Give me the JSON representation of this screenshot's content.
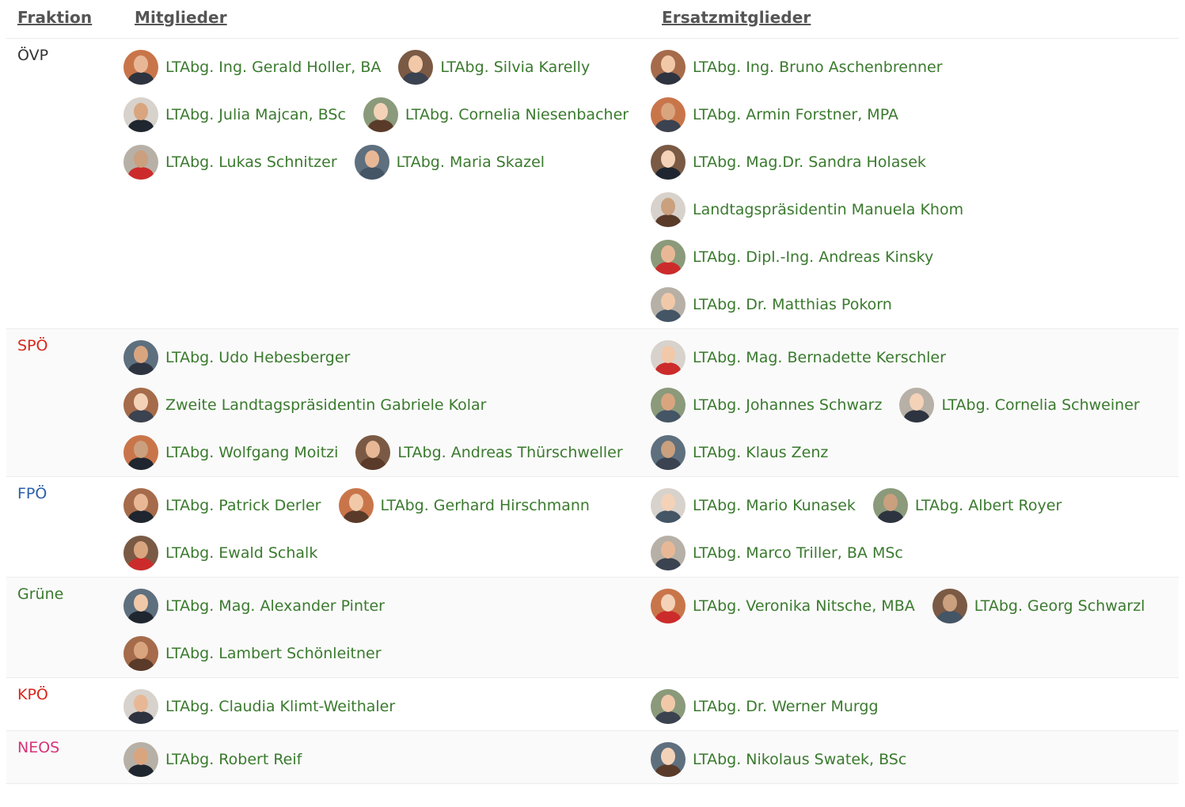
{
  "header": {
    "fraktion": "Fraktion",
    "mitglieder": "Mitglieder",
    "ersatzmitglieder": "Ersatzmitglieder"
  },
  "colors": {
    "link": "#3a7a2e",
    "ÖVP": "#333333",
    "SPÖ": "#d9261c",
    "FPÖ": "#2b5fab",
    "Grüne": "#3a7a2e",
    "KPÖ": "#d9261c",
    "NEOS": "#d6347a"
  },
  "rows": [
    {
      "party": "ÖVP",
      "members": [
        [
          "LTAbg. Ing. Gerald Holler, BA",
          "LTAbg. Silvia Karelly"
        ],
        [
          "LTAbg. Julia Majcan, BSc",
          "LTAbg. Cornelia Niesenbacher"
        ],
        [
          "LTAbg. Lukas Schnitzer",
          "LTAbg. Maria Skazel"
        ]
      ],
      "substitutes": [
        [
          "LTAbg. Ing. Bruno Aschenbrenner"
        ],
        [
          "LTAbg. Armin Forstner, MPA"
        ],
        [
          "LTAbg. Mag.Dr. Sandra Holasek"
        ],
        [
          "Landtagspräsidentin Manuela Khom"
        ],
        [
          "LTAbg. Dipl.-Ing. Andreas Kinsky"
        ],
        [
          "LTAbg. Dr. Matthias Pokorn"
        ]
      ]
    },
    {
      "party": "SPÖ",
      "members": [
        [
          "LTAbg. Udo Hebesberger"
        ],
        [
          "Zweite Landtagspräsidentin Gabriele Kolar"
        ],
        [
          "LTAbg. Wolfgang Moitzi",
          "LTAbg. Andreas Thürschweller"
        ]
      ],
      "substitutes": [
        [
          "LTAbg. Mag. Bernadette Kerschler"
        ],
        [
          "LTAbg. Johannes Schwarz",
          "LTAbg. Cornelia Schweiner"
        ],
        [
          "LTAbg. Klaus Zenz"
        ]
      ]
    },
    {
      "party": "FPÖ",
      "members": [
        [
          "LTAbg. Patrick Derler",
          "LTAbg. Gerhard Hirschmann"
        ],
        [
          "LTAbg. Ewald Schalk"
        ]
      ],
      "substitutes": [
        [
          "LTAbg. Mario Kunasek",
          "LTAbg. Albert Royer"
        ],
        [
          "LTAbg. Marco Triller, BA MSc"
        ]
      ]
    },
    {
      "party": "Grüne",
      "members": [
        [
          "LTAbg. Mag. Alexander Pinter"
        ],
        [
          "LTAbg. Lambert Schönleitner"
        ]
      ],
      "substitutes": [
        [
          "LTAbg. Veronika Nitsche, MBA",
          "LTAbg. Georg Schwarzl"
        ]
      ]
    },
    {
      "party": "KPÖ",
      "members": [
        [
          "LTAbg. Claudia Klimt-Weithaler"
        ]
      ],
      "substitutes": [
        [
          "LTAbg. Dr. Werner Murgg"
        ]
      ]
    },
    {
      "party": "NEOS",
      "members": [
        [
          "LTAbg. Robert Reif"
        ]
      ],
      "substitutes": [
        [
          "LTAbg. Nikolaus Swatek, BSc"
        ]
      ]
    }
  ]
}
